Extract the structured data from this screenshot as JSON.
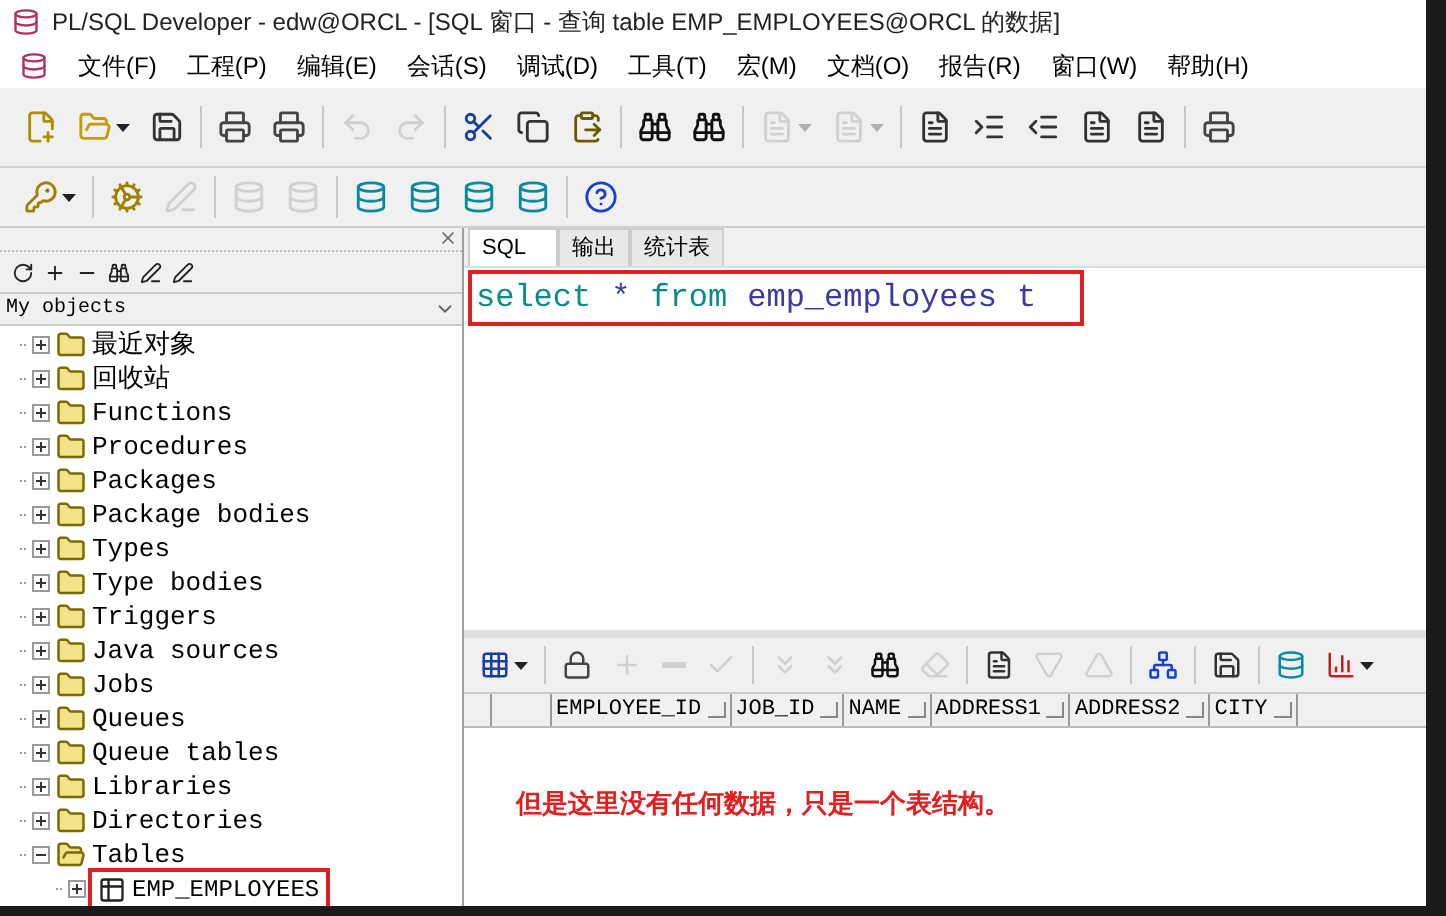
{
  "window": {
    "title": "PL/SQL Developer - edw@ORCL - [SQL 窗口 - 查询 table EMP_EMPLOYEES@ORCL 的数据]"
  },
  "menu": [
    "文件(F)",
    "工程(P)",
    "编辑(E)",
    "会话(S)",
    "调试(D)",
    "工具(T)",
    "宏(M)",
    "文档(O)",
    "报告(R)",
    "窗口(W)",
    "帮助(H)"
  ],
  "toolbar_1": [
    [
      {
        "kind": "new",
        "disabled": false
      },
      {
        "kind": "open",
        "disabled": false,
        "caret": true
      },
      {
        "kind": "save",
        "disabled": false
      }
    ],
    [
      {
        "kind": "print",
        "disabled": false
      },
      {
        "kind": "print",
        "disabled": false
      }
    ],
    [
      {
        "kind": "undo",
        "disabled": true
      },
      {
        "kind": "redo",
        "disabled": true
      }
    ],
    [
      {
        "kind": "cut",
        "disabled": false
      },
      {
        "kind": "copy",
        "disabled": false
      },
      {
        "kind": "paste",
        "disabled": false
      }
    ],
    [
      {
        "kind": "find",
        "disabled": false
      },
      {
        "kind": "find",
        "disabled": false
      }
    ],
    [
      {
        "kind": "doc",
        "disabled": true,
        "caret": true
      },
      {
        "kind": "doc",
        "disabled": true,
        "caret": true
      }
    ],
    [
      {
        "kind": "doc",
        "disabled": false
      },
      {
        "kind": "indent",
        "disabled": false
      },
      {
        "kind": "outdent",
        "disabled": false
      },
      {
        "kind": "doc",
        "disabled": false
      },
      {
        "kind": "doc",
        "disabled": false
      }
    ],
    [
      {
        "kind": "print",
        "disabled": false
      }
    ]
  ],
  "toolbar_2": [
    [
      {
        "kind": "key",
        "disabled": false,
        "caret": true
      }
    ],
    [
      {
        "kind": "gear",
        "disabled": false
      },
      {
        "kind": "pen",
        "disabled": true
      }
    ],
    [
      {
        "kind": "db",
        "disabled": true
      },
      {
        "kind": "db",
        "disabled": true
      }
    ],
    [
      {
        "kind": "db",
        "disabled": false
      },
      {
        "kind": "db",
        "disabled": false
      },
      {
        "kind": "db",
        "disabled": false
      },
      {
        "kind": "db",
        "disabled": false
      }
    ],
    [
      {
        "kind": "help",
        "disabled": false
      }
    ]
  ],
  "object_browser": {
    "filter": "My objects",
    "tree": [
      {
        "label": "最近对象",
        "expanded": false
      },
      {
        "label": "回收站",
        "expanded": false
      },
      {
        "label": "Functions",
        "expanded": false
      },
      {
        "label": "Procedures",
        "expanded": false
      },
      {
        "label": "Packages",
        "expanded": false
      },
      {
        "label": "Package bodies",
        "expanded": false
      },
      {
        "label": "Types",
        "expanded": false
      },
      {
        "label": "Type bodies",
        "expanded": false
      },
      {
        "label": "Triggers",
        "expanded": false
      },
      {
        "label": "Java sources",
        "expanded": false
      },
      {
        "label": "Jobs",
        "expanded": false
      },
      {
        "label": "Queues",
        "expanded": false
      },
      {
        "label": "Queue tables",
        "expanded": false
      },
      {
        "label": "Libraries",
        "expanded": false
      },
      {
        "label": "Directories",
        "expanded": false
      },
      {
        "label": "Tables",
        "expanded": true,
        "children": [
          {
            "label": "EMP_EMPLOYEES",
            "expanded": false,
            "highlighted": true
          }
        ]
      }
    ]
  },
  "tabs": [
    {
      "label": "SQL",
      "selected": true
    },
    {
      "label": "输出",
      "selected": false
    },
    {
      "label": "统计表",
      "selected": false
    }
  ],
  "editor": {
    "highlighted": true,
    "tokens": [
      {
        "text": "select",
        "kind": "keyword"
      },
      {
        "text": "*",
        "kind": "identifier"
      },
      {
        "text": "from",
        "kind": "keyword"
      },
      {
        "text": "emp_employees",
        "kind": "identifier"
      },
      {
        "text": "t",
        "kind": "identifier"
      }
    ]
  },
  "grid_toolbar": [
    [
      {
        "kind": "grid",
        "disabled": false,
        "caret": true
      }
    ],
    [
      {
        "kind": "lock",
        "disabled": false
      },
      {
        "kind": "plus",
        "disabled": true
      },
      {
        "kind": "minus",
        "disabled": true
      },
      {
        "kind": "check",
        "disabled": true
      }
    ],
    [
      {
        "kind": "chevrons",
        "disabled": true
      },
      {
        "kind": "chevrons",
        "disabled": true
      },
      {
        "kind": "find",
        "disabled": false
      },
      {
        "kind": "eraser",
        "disabled": true
      }
    ],
    [
      {
        "kind": "doc",
        "disabled": false
      },
      {
        "kind": "down",
        "disabled": true
      },
      {
        "kind": "up",
        "disabled": true
      }
    ],
    [
      {
        "kind": "tree",
        "disabled": false
      }
    ],
    [
      {
        "kind": "save",
        "disabled": false
      }
    ],
    [
      {
        "kind": "db",
        "disabled": false
      },
      {
        "kind": "chart",
        "disabled": false,
        "caret": true
      }
    ]
  ],
  "grid": {
    "columns": [
      "EMPLOYEE_ID",
      "JOB_ID",
      "NAME",
      "ADDRESS1",
      "ADDRESS2",
      "CITY"
    ],
    "note": "但是这里没有任何数据，只是一个表结构。"
  }
}
